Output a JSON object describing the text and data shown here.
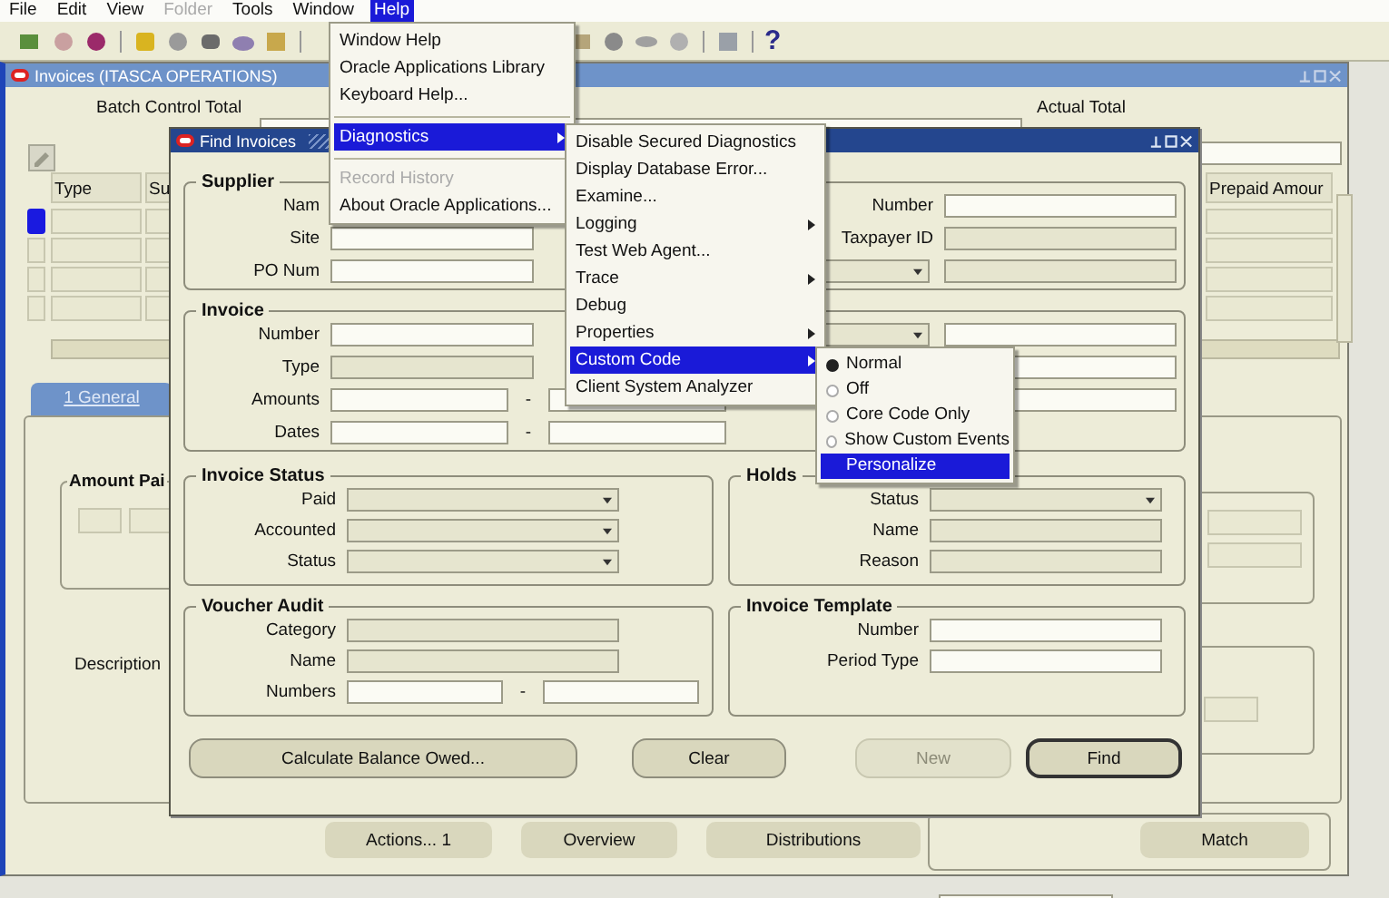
{
  "menu_bar": [
    {
      "label": "File",
      "selected": false,
      "disabled": false
    },
    {
      "label": "Edit",
      "selected": false,
      "disabled": false
    },
    {
      "label": "View",
      "selected": false,
      "disabled": false
    },
    {
      "label": "Folder",
      "selected": false,
      "disabled": true
    },
    {
      "label": "Tools",
      "selected": false,
      "disabled": false
    },
    {
      "label": "Window",
      "selected": false,
      "disabled": false
    },
    {
      "label": "Help",
      "selected": true,
      "disabled": false
    }
  ],
  "toolbar": {
    "help_glyph": "?"
  },
  "invoices_window": {
    "title": "Invoices (ITASCA OPERATIONS)",
    "batch_control_total": "Batch Control Total",
    "actual_total": "Actual Total",
    "columns": [
      {
        "label": "Type"
      },
      {
        "label": "Su"
      },
      {
        "label": "Prepaid Amour"
      }
    ],
    "tab": {
      "label": "1 General",
      "selected": true
    },
    "amount_paid_group": "Amount Pai",
    "description_label": "Description",
    "buttons": [
      {
        "label": "Actions... 1"
      },
      {
        "label": "Overview"
      },
      {
        "label": "Distributions"
      }
    ],
    "match_button": "Match"
  },
  "find_dialog": {
    "title": "Find Invoices",
    "groups": [
      {
        "title": "Supplier",
        "left": [
          {
            "label": "Nam"
          },
          {
            "label": "Site",
            "fields": [
              {
                "kind": "text",
                "disabled": false
              }
            ]
          },
          {
            "label": "PO Num",
            "fields": [
              {
                "kind": "text",
                "disabled": false
              }
            ]
          }
        ],
        "right": [
          {
            "label": "Number",
            "fields": [
              {
                "kind": "text",
                "disabled": false
              }
            ]
          },
          {
            "label": "Taxpayer ID",
            "fields": [
              {
                "kind": "text",
                "disabled": true
              }
            ]
          },
          {
            "fields": [
              {
                "kind": "dropdown",
                "disabled": true
              },
              {
                "kind": "text",
                "disabled": true
              }
            ]
          }
        ]
      },
      {
        "title": "Invoice",
        "left": [
          {
            "label": "Number",
            "fields": [
              {
                "kind": "text",
                "disabled": false
              }
            ]
          },
          {
            "label": "Type",
            "fields": [
              {
                "kind": "text",
                "disabled": true
              }
            ]
          },
          {
            "label": "Amounts",
            "fields": [
              {
                "kind": "text",
                "disabled": false
              },
              {
                "kind": "dash",
                "text": "-"
              },
              {
                "kind": "text",
                "disabled": false
              }
            ]
          },
          {
            "label": "Dates",
            "fields": [
              {
                "kind": "text",
                "disabled": false
              },
              {
                "kind": "dash",
                "text": "-"
              },
              {
                "kind": "text",
                "disabled": false
              }
            ]
          }
        ],
        "right": [
          {
            "fields": [
              {
                "kind": "dropdown",
                "disabled": true
              },
              {
                "kind": "text",
                "disabled": false
              }
            ]
          },
          {
            "fields": [
              {
                "kind": "text",
                "disabled": false
              }
            ]
          },
          {
            "fields": [
              {
                "kind": "text",
                "disabled": false
              }
            ]
          }
        ]
      }
    ],
    "small_groups": [
      {
        "title": "Invoice Status",
        "rows": [
          {
            "label": "Paid",
            "fields": [
              {
                "kind": "dropdown",
                "disabled": true
              }
            ]
          },
          {
            "label": "Accounted",
            "fields": [
              {
                "kind": "dropdown",
                "disabled": true
              }
            ]
          },
          {
            "label": "Status",
            "fields": [
              {
                "kind": "dropdown",
                "disabled": true
              }
            ]
          }
        ]
      },
      {
        "title": "Holds",
        "rows": [
          {
            "label": "Status",
            "fields": [
              {
                "kind": "dropdown",
                "disabled": true
              }
            ]
          },
          {
            "label": "Name",
            "fields": [
              {
                "kind": "text",
                "disabled": true
              }
            ]
          },
          {
            "label": "Reason",
            "fields": [
              {
                "kind": "text",
                "disabled": true
              }
            ]
          }
        ]
      },
      {
        "title": "Voucher Audit",
        "rows": [
          {
            "label": "Category",
            "fields": [
              {
                "kind": "text",
                "disabled": true
              }
            ]
          },
          {
            "label": "Name",
            "fields": [
              {
                "kind": "text",
                "disabled": true
              }
            ]
          },
          {
            "label": "Numbers",
            "fields": [
              {
                "kind": "text",
                "disabled": false
              },
              {
                "kind": "dash",
                "text": "-"
              },
              {
                "kind": "text",
                "disabled": false
              }
            ]
          }
        ]
      },
      {
        "title": "Invoice Template",
        "rows": [
          {
            "label": "Number",
            "fields": [
              {
                "kind": "text",
                "disabled": false
              }
            ]
          },
          {
            "label": "Period Type",
            "fields": [
              {
                "kind": "text",
                "disabled": false
              }
            ]
          }
        ]
      }
    ],
    "buttons": [
      {
        "label": "Calculate Balance Owed...",
        "disabled": false,
        "default": false
      },
      {
        "label": "Clear",
        "disabled": false,
        "default": false
      },
      {
        "label": "New",
        "disabled": true,
        "default": false
      },
      {
        "label": "Find",
        "disabled": false,
        "default": true
      }
    ]
  },
  "help_menu": [
    {
      "kind": "item",
      "label": "Window Help",
      "selected": false,
      "disabled": false,
      "submenu": false
    },
    {
      "kind": "item",
      "label": "Oracle Applications Library",
      "selected": false,
      "disabled": false,
      "submenu": false
    },
    {
      "kind": "item",
      "label": "Keyboard Help...",
      "selected": false,
      "disabled": false,
      "submenu": false
    },
    {
      "kind": "separator"
    },
    {
      "kind": "item",
      "label": "Diagnostics",
      "selected": true,
      "disabled": false,
      "submenu": true
    },
    {
      "kind": "separator"
    },
    {
      "kind": "item",
      "label": "Record History",
      "selected": false,
      "disabled": true,
      "submenu": false
    },
    {
      "kind": "item",
      "label": "About Oracle Applications...",
      "selected": false,
      "disabled": false,
      "submenu": false
    }
  ],
  "diagnostics_menu": [
    {
      "kind": "item",
      "label": "Disable Secured Diagnostics",
      "selected": false,
      "disabled": false,
      "submenu": false
    },
    {
      "kind": "item",
      "label": "Display Database Error...",
      "selected": false,
      "disabled": false,
      "submenu": false
    },
    {
      "kind": "item",
      "label": "Examine...",
      "selected": false,
      "disabled": false,
      "submenu": false
    },
    {
      "kind": "item",
      "label": "Logging",
      "selected": false,
      "disabled": false,
      "submenu": true
    },
    {
      "kind": "item",
      "label": "Test Web Agent...",
      "selected": false,
      "disabled": false,
      "submenu": false
    },
    {
      "kind": "item",
      "label": "Trace",
      "selected": false,
      "disabled": false,
      "submenu": true
    },
    {
      "kind": "item",
      "label": "Debug",
      "selected": false,
      "disabled": false,
      "submenu": false
    },
    {
      "kind": "item",
      "label": "Properties",
      "selected": false,
      "disabled": false,
      "submenu": true
    },
    {
      "kind": "item",
      "label": "Custom Code",
      "selected": true,
      "disabled": false,
      "submenu": true
    },
    {
      "kind": "item",
      "label": "Client System Analyzer",
      "selected": false,
      "disabled": false,
      "submenu": false
    }
  ],
  "custom_code_menu": [
    {
      "kind": "radio",
      "label": "Normal",
      "checked": true,
      "selected": false
    },
    {
      "kind": "radio",
      "label": "Off",
      "checked": false,
      "selected": false
    },
    {
      "kind": "radio",
      "label": "Core Code Only",
      "checked": false,
      "selected": false
    },
    {
      "kind": "radio",
      "label": "Show Custom Events",
      "checked": false,
      "selected": false
    },
    {
      "kind": "item",
      "label": "Personalize",
      "selected": true,
      "disabled": false,
      "submenu": false
    }
  ]
}
